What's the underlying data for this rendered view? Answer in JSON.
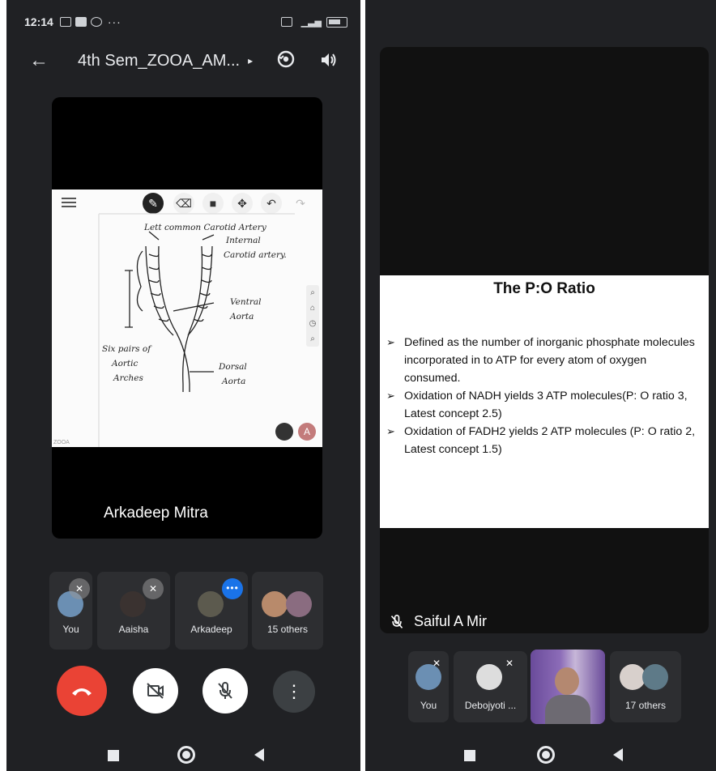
{
  "left_screen": {
    "status_bar": {
      "time": "12:14",
      "extra": "···"
    },
    "app_bar": {
      "title": "4th Sem_ZOOA_AM...",
      "caret": "▸"
    },
    "main_video": {
      "speaker_name": "Arkadeep Mitra",
      "whiteboard_toolbar": [
        "pen-icon",
        "eraser-icon",
        "sticky-note-icon",
        "move-icon",
        "undo-icon",
        "redo-icon"
      ],
      "annotations": {
        "top": "Lett common Carotid Artery",
        "internal": "Internal",
        "carotid": "Carotid artery.",
        "ventral": "Ventral",
        "ventral2": "Aorta",
        "six": "Six pairs of",
        "aortic": "Aortic",
        "arches": "Arches",
        "dorsal": "Dorsal",
        "dorsal2": "Aorta"
      },
      "avatar_initial": "A",
      "footer": "ZOOA"
    },
    "participants": [
      {
        "name": "You",
        "muted": true
      },
      {
        "name": "Aaisha",
        "muted": true
      },
      {
        "name": "Arkadeep",
        "speaking": true
      },
      {
        "name": "15 others"
      }
    ],
    "controls": [
      "end-call",
      "camera-off",
      "mic-off",
      "more-options"
    ],
    "more_symbol": "⋮"
  },
  "right_screen": {
    "slide": {
      "title": "The P:O Ratio",
      "bullets": [
        "Defined as the number of inorganic phosphate molecules incorporated in to ATP for every atom of oxygen consumed.",
        "Oxidation of NADH yields 3 ATP molecules(P: O ratio 3, Latest concept 2.5)",
        "Oxidation of FADH2 yields 2 ATP molecules (P: O ratio 2, Latest concept 1.5)"
      ]
    },
    "speaker_name": "Saiful A Mir",
    "participants": [
      {
        "name": "You",
        "muted": true
      },
      {
        "name": "Debojyoti ...",
        "muted": true
      },
      {
        "name": "",
        "video": true
      },
      {
        "name": "17 others"
      }
    ]
  },
  "colors": {
    "background": "#202124",
    "tile": "#2d2e31",
    "hangup": "#ea4335",
    "accent": "#1a73e8"
  }
}
